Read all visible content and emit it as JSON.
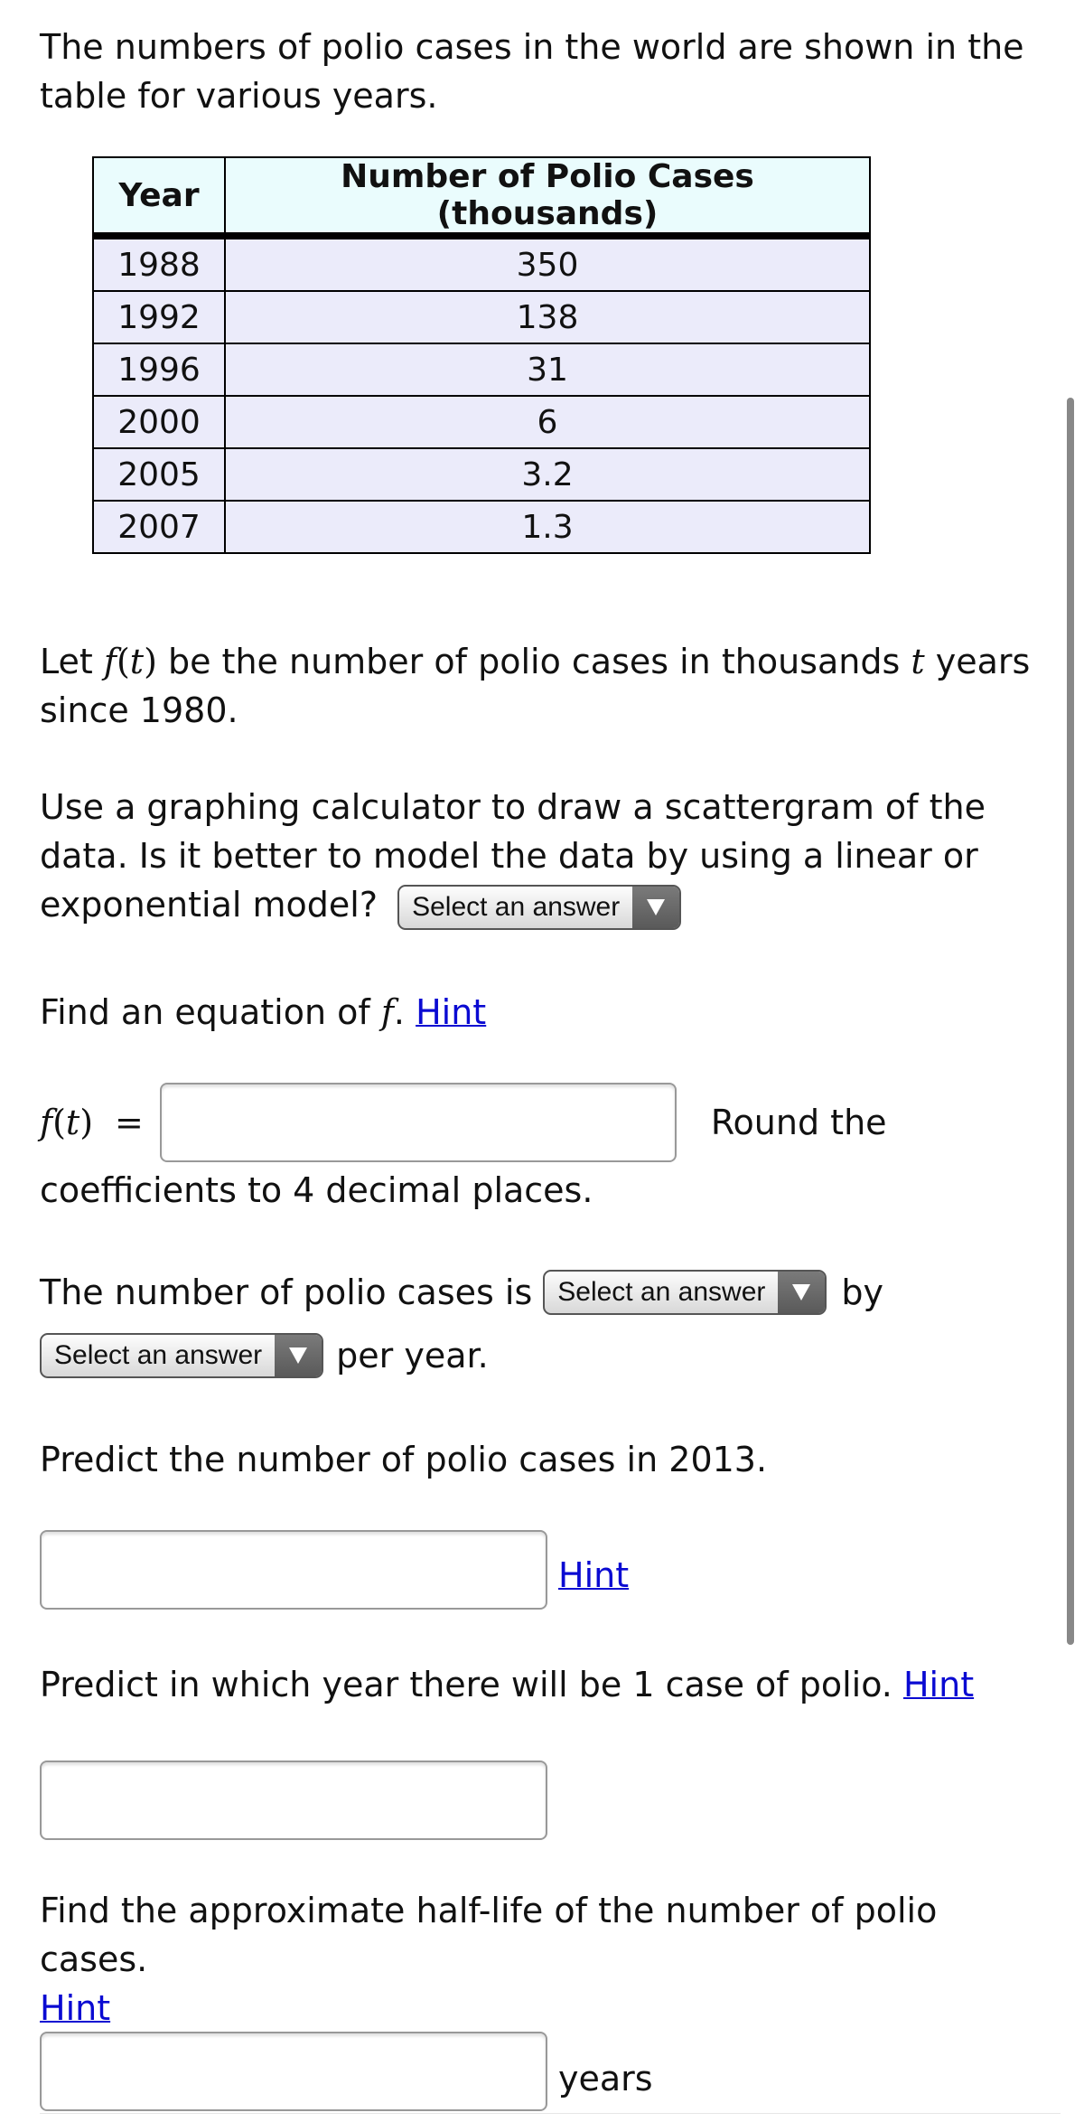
{
  "intro": "The numbers of polio cases in the world are shown in the table for various years.",
  "table": {
    "headers": [
      "Year",
      "Number of Polio Cases (thousands)"
    ],
    "rows": [
      {
        "year": "1988",
        "cases": "350"
      },
      {
        "year": "1992",
        "cases": "138"
      },
      {
        "year": "1996",
        "cases": "31"
      },
      {
        "year": "2000",
        "cases": "6"
      },
      {
        "year": "2005",
        "cases": "3.2"
      },
      {
        "year": "2007",
        "cases": "1.3"
      }
    ]
  },
  "definition": {
    "pre": "Let ",
    "func": "f",
    "open": "(",
    "var": "t",
    "close": ")",
    "mid": " be the number of polio cases in thousands ",
    "var2": "t",
    "post": " years since 1980."
  },
  "q1": {
    "text": "Use a graphing calculator to draw a scattergram of the data. Is it better to model the data by using a linear or exponential model?",
    "select_label": "Select an answer"
  },
  "q2": {
    "text": "Find an equation of ",
    "func": "f",
    "period": ". ",
    "hint": "Hint",
    "eq_func": "f",
    "eq_var": "t",
    "eq_sign": "=",
    "input_value": "",
    "after_input": "Round the",
    "note": "coefficients to 4 decimal places."
  },
  "q3": {
    "text_pre": "The number of polio cases is",
    "select1_label": "Select an answer",
    "text_mid": "by",
    "select2_label": "Select an answer",
    "text_post": "per year."
  },
  "q4": {
    "text": "Predict the number of polio cases in 2013.",
    "input_value": "",
    "hint": "Hint"
  },
  "q5": {
    "text": "Predict in which year there will be 1 case of polio.",
    "hint": "Hint",
    "input_value": ""
  },
  "q6": {
    "text": "Find the approximate half-life of the number of polio cases.",
    "hint": "Hint",
    "input_value": "",
    "unit": "years"
  },
  "colors": {
    "header_bg": "#eafcfd",
    "row_bg": "#ebebfa",
    "link": "#0a0ad2",
    "scrollbar": "#888888"
  }
}
